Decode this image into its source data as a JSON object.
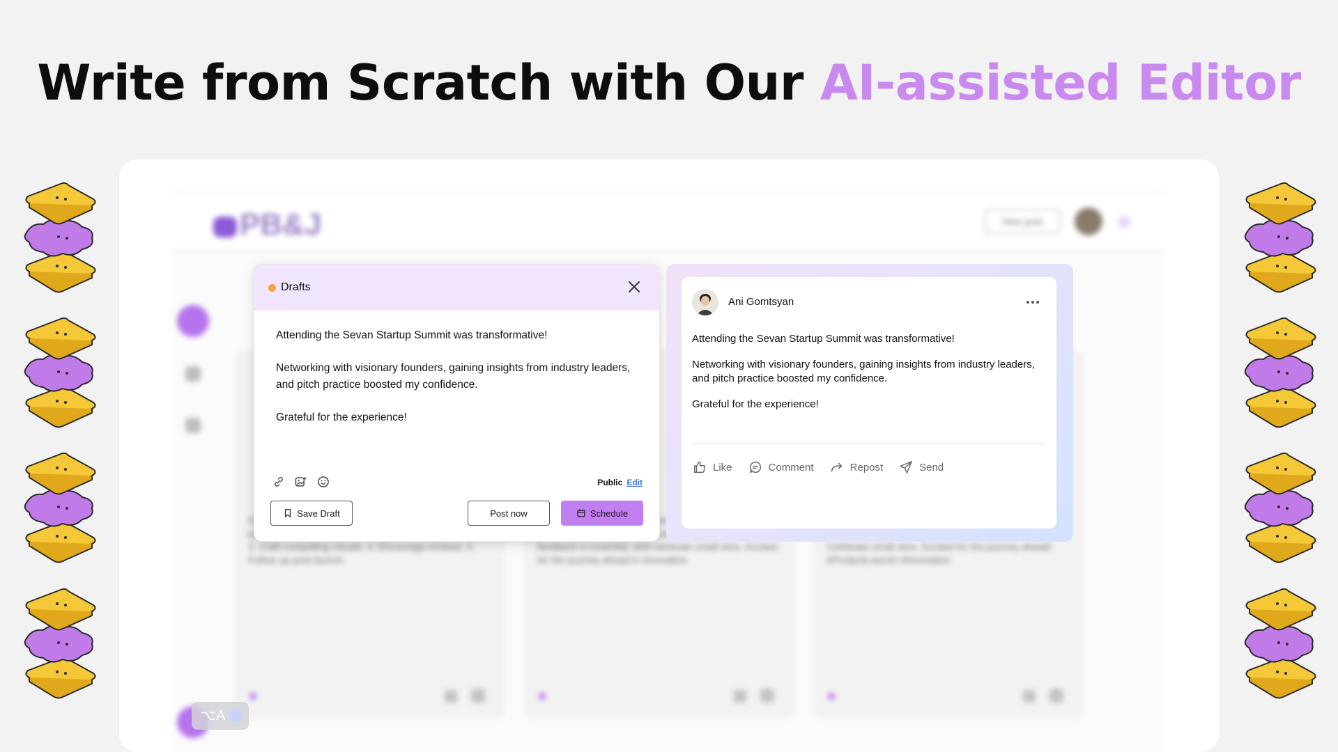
{
  "headline": {
    "prefix": "Write from Scratch with Our ",
    "accent": "AI-assisted Editor",
    "accent_color": "#c98af0"
  },
  "background_app": {
    "logo": "PB&J",
    "new_post_label": "New post",
    "cards": [
      {
        "text": "Successful Product Hunt launch tactics: 1. Build a solid pre-launch community. 2. Engage with early adopters. 3. Craft compelling visuals. 4. Encourage reviews. 5. Follow up post-launch."
      },
      {
        "text": "Key takeaways from our recent product launch: Understand your audience, value partnerships, feedback is essential, and celebrate small wins. Excited for the journey ahead in innovation."
      },
      {
        "text": "Key takeaways from our product launch: Understand your audience. Value of partnerships. Feedback is gold. Celebrate small wins. Excited for the journey ahead! #ProductLaunch #Innovation"
      }
    ]
  },
  "ai_chip": {
    "shortcut": "⌥A"
  },
  "editor": {
    "status_color": "#f4a43b",
    "title": "Drafts",
    "paragraphs": [
      "Attending the Sevan Startup Summit was transformative!",
      "Networking with visionary founders, gaining insights from industry leaders, and pitch practice boosted my confidence.",
      "Grateful for the experience!"
    ],
    "tools": [
      "link-icon",
      "image-sparkle-icon",
      "emoji-icon"
    ],
    "visibility": "Public",
    "edit_label": "Edit",
    "save_draft_label": "Save Draft",
    "post_now_label": "Post now",
    "schedule_label": "Schedule",
    "schedule_color": "#c17ef0"
  },
  "preview": {
    "author": "Ani Gomtsyan",
    "paragraphs": [
      "Attending the Sevan Startup Summit was transformative!",
      "Networking with visionary founders, gaining insights from industry leaders, and pitch practice boosted my confidence.",
      "Grateful for the experience!"
    ],
    "actions": [
      {
        "icon": "thumbs-up-icon",
        "label": "Like"
      },
      {
        "icon": "comment-icon",
        "label": "Comment"
      },
      {
        "icon": "repost-icon",
        "label": "Repost"
      },
      {
        "icon": "send-icon",
        "label": "Send"
      }
    ]
  }
}
